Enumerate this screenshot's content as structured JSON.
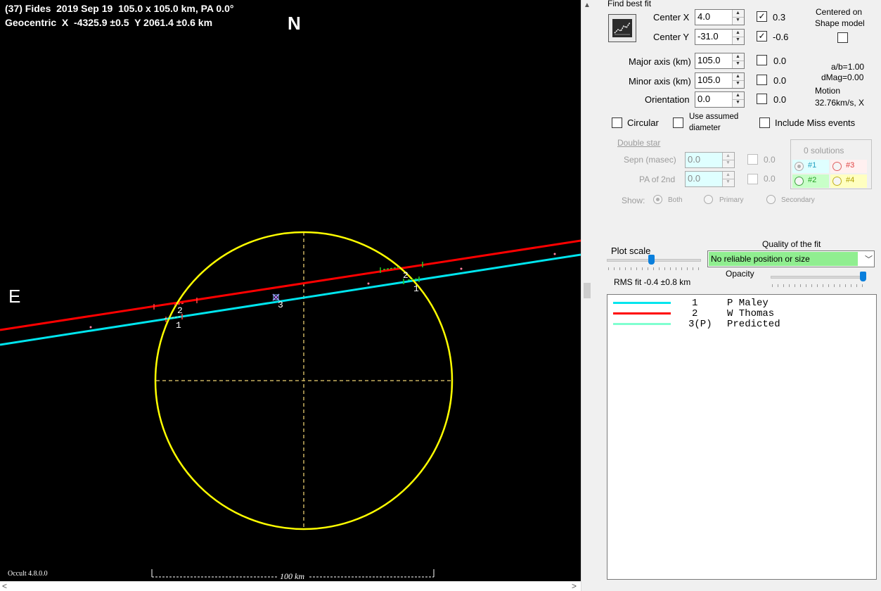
{
  "plot": {
    "title_line1": "(37) Fides  2019 Sep 19  105.0 x 105.0 km, PA 0.0°",
    "title_line2": "Geocentric  X  -4325.9 ±0.5  Y 2061.4 ±0.6 km",
    "north_label": "N",
    "east_label": "E",
    "scale_label": "100 km",
    "chord_labels": [
      "2",
      "1",
      "2",
      "1",
      "3"
    ],
    "version": "Occult 4.8.0.0",
    "colors": {
      "background": "#000000",
      "ellipse": "#ffff00",
      "axes": "#c8b060",
      "chord_1": "#00e5ee",
      "chord_2": "#ff0000",
      "predicted": "#80ffd0"
    }
  },
  "panel": {
    "find_best_fit_label": "Find best fit",
    "find_best_fit_icon": "graph-fit-icon",
    "center_x": {
      "label": "Center X",
      "value": "4.0",
      "checked": true,
      "check_value": "0.3"
    },
    "center_y": {
      "label": "Center Y",
      "value": "-31.0",
      "checked": true,
      "check_value": "-0.6"
    },
    "major_axis": {
      "label": "Major axis (km)",
      "value": "105.0",
      "checked": false,
      "check_value": "0.0"
    },
    "minor_axis": {
      "label": "Minor axis (km)",
      "value": "105.0",
      "checked": false,
      "check_value": "0.0"
    },
    "orientation": {
      "label": "Orientation",
      "value": "0.0",
      "checked": false,
      "check_value": "0.0"
    },
    "centered_on_label_1": "Centered on",
    "centered_on_label_2": "Shape model",
    "ab_ratio": "a/b=1.00",
    "dmag": "dMag=0.00",
    "motion_label": "Motion",
    "motion_value": "32.76km/s, X",
    "circular_label": "Circular",
    "use_assumed_label_1": "Use assumed",
    "use_assumed_label_2": "diameter",
    "include_miss_label": "Include Miss events",
    "double_star": {
      "title": "Double star",
      "sepn_label": "Sepn (masec)",
      "sepn_value": "0.0",
      "sepn_check_value": "0.0",
      "pa_label": "PA of 2nd",
      "pa_value": "0.0",
      "pa_check_value": "0.0",
      "show_label": "Show:",
      "show_options": [
        "Both",
        "Primary",
        "Secondary"
      ],
      "solutions_label": "0 solutions",
      "solutions": [
        {
          "label": "#1",
          "color": "#dfffff"
        },
        {
          "label": "#3",
          "color": "#fff0f0"
        },
        {
          "label": "#2",
          "color": "#c8ffc8"
        },
        {
          "label": "#4",
          "color": "#ffffc0"
        }
      ]
    },
    "plot_scale_label": "Plot scale",
    "quality_label": "Quality of the fit",
    "quality_value": "No reliable position or size",
    "opacity_label": "Opacity",
    "rms_fit": "RMS fit -0.4 ±0.8 km",
    "legend": [
      {
        "id": "1",
        "name": "P Maley",
        "color": "#00e5ee"
      },
      {
        "id": "2",
        "name": "W Thomas",
        "color": "#ff0000"
      },
      {
        "id": "3(P)",
        "name": "Predicted",
        "color": "#80ffd0"
      }
    ]
  }
}
